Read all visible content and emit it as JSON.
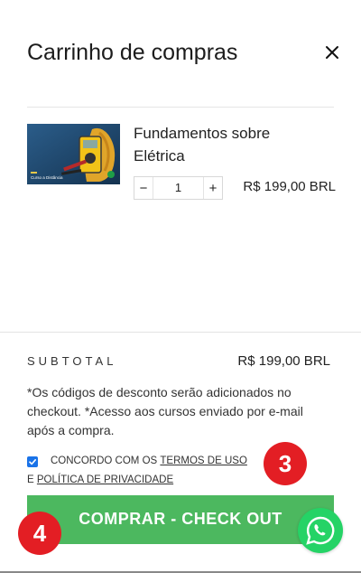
{
  "header": {
    "title": "Carrinho de compras",
    "close_icon": "close-icon"
  },
  "item": {
    "name": "Fundamentos sobre Elétrica",
    "thumb_caption": "Curso a Distância",
    "quantity": "1",
    "minus_label": "−",
    "plus_label": "+",
    "price": "R$ 199,00 BRL"
  },
  "summary": {
    "subtotal_label": "SUBTOTAL",
    "subtotal_value": "R$ 199,00 BRL",
    "note": "*Os códigos de desconto serão adicionados no checkout. *Acesso aos cursos enviado por e-mail após a compra."
  },
  "agreement": {
    "checked": true,
    "prefix": "CONCORDO COM OS",
    "terms_link": "TERMOS DE USO",
    "conjunction": "E",
    "privacy_link": "POLÍTICA DE PRIVACIDADE"
  },
  "markers": {
    "three": "3",
    "four": "4"
  },
  "checkout": {
    "label": "COMPRAR - CHECK OUT"
  },
  "colors": {
    "checkout": "#4cb85f",
    "badge": "#e31e24",
    "whatsapp": "#25d366",
    "checkbox": "#1a73e8"
  }
}
